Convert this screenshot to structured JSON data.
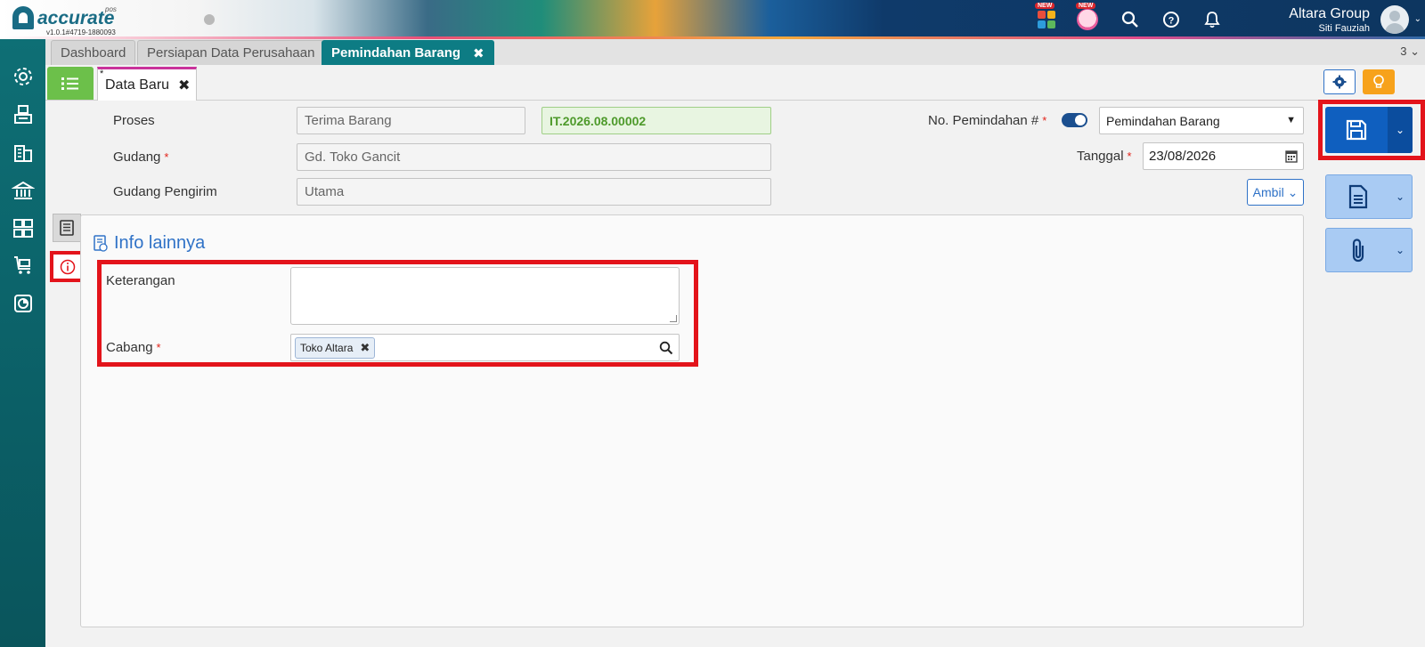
{
  "app": {
    "logo_text": "accurate",
    "logo_sub": "pos",
    "version": "v1.0.1#4719-1880093"
  },
  "header": {
    "company_name": "Altara Group",
    "user_name": "Siti Fauziah",
    "new_badge_1": "NEW",
    "new_badge_2": "NEW",
    "icons": [
      "apps-icon",
      "mascot-icon",
      "search-icon",
      "help-icon",
      "bell-icon",
      "avatar"
    ]
  },
  "tabs": {
    "items": [
      {
        "label": "Dashboard"
      },
      {
        "label": "Persiapan Data Perusahaan"
      },
      {
        "label": "Pemindahan Barang",
        "active": true
      }
    ],
    "close_symbol": "✖",
    "count": "3"
  },
  "subtabs": {
    "doc_label": "Data Baru",
    "modified_marker": "*",
    "close_symbol": "✖"
  },
  "form": {
    "proses_label": "Proses",
    "proses_value": "Terima Barang",
    "proses_number": "IT.2026.08.00002",
    "gudang_label": "Gudang",
    "gudang_value": "Gd. Toko Gancit",
    "gudang_pengirim_label": "Gudang Pengirim",
    "gudang_pengirim_value": "Utama",
    "no_pemindahan_label": "No. Pemindahan #",
    "no_pemindahan_type": "Pemindahan Barang",
    "tanggal_label": "Tanggal",
    "tanggal_value": "23/08/2026",
    "ambil_label": "Ambil",
    "required_mark": "*"
  },
  "panel": {
    "title": "Info lainnya",
    "keterangan_label": "Keterangan",
    "keterangan_value": "",
    "cabang_label": "Cabang",
    "cabang_chip": "Toko Altara"
  },
  "colors": {
    "brand_teal": "#0d7c84",
    "accent_blue": "#0f5fbf",
    "highlight_red": "#e3141b",
    "ok_green": "#6cc04a"
  }
}
